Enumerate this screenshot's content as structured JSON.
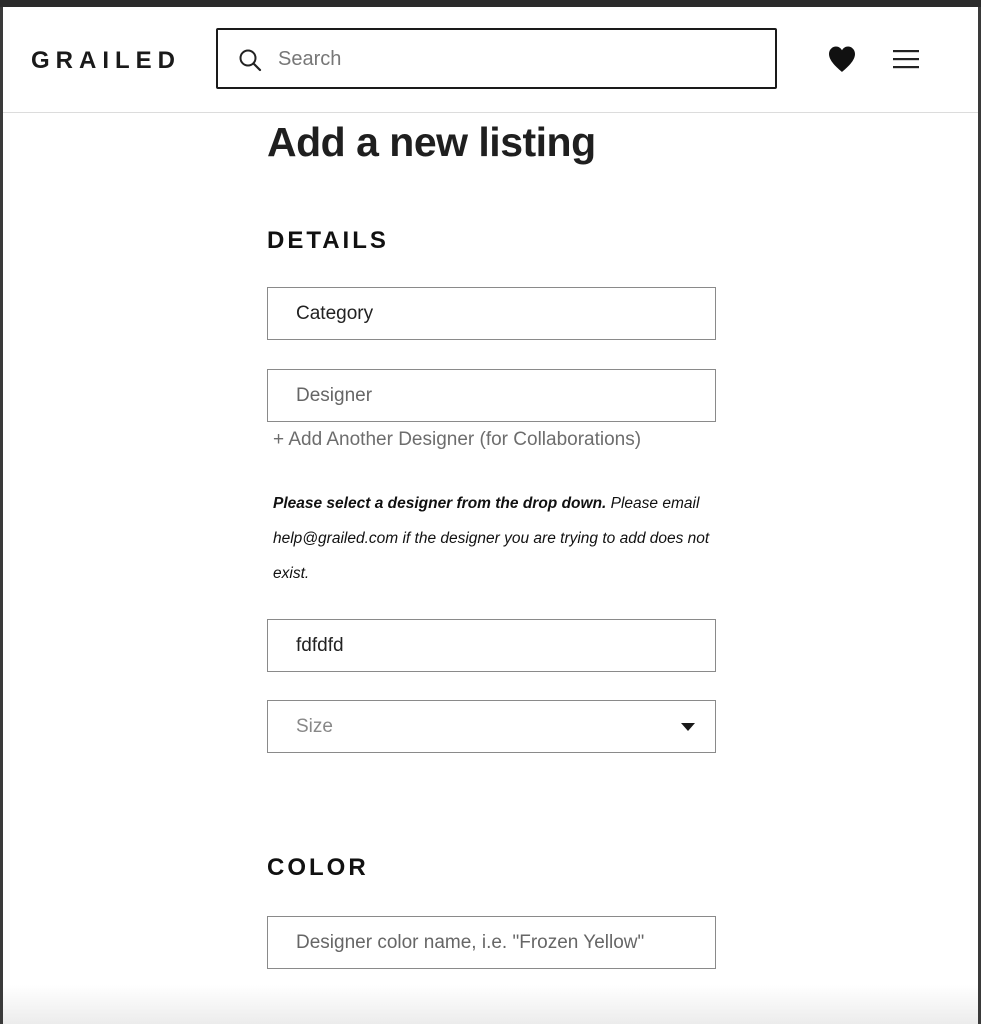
{
  "header": {
    "logo": "GRAILED",
    "search_placeholder": "Search"
  },
  "page": {
    "title": "Add a new listing"
  },
  "details": {
    "heading": "DETAILS",
    "category_value": "Category",
    "designer_placeholder": "Designer",
    "add_designer_link": "+ Add Another Designer (for Collaborations)",
    "note_bold": "Please select a designer from the drop down.",
    "note_rest": " Please email help@grailed.com if the designer you are trying to add does not exist.",
    "item_name_value": "fdfdfd",
    "size_placeholder": "Size"
  },
  "color": {
    "heading": "COLOR",
    "color_placeholder": "Designer color name, i.e. \"Frozen Yellow\""
  },
  "icons": {
    "search": "search-icon",
    "heart": "heart-icon",
    "menu": "hamburger-menu-icon",
    "caret": "caret-down-icon"
  }
}
